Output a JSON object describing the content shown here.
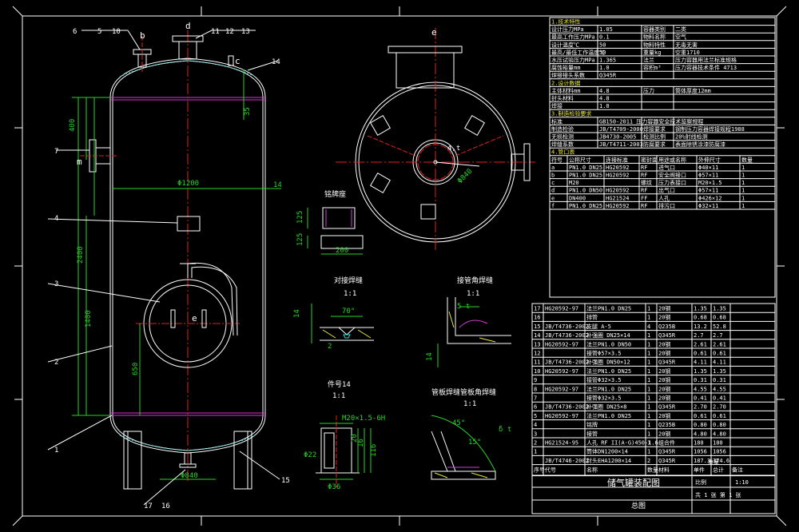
{
  "drawing": {
    "dims": {
      "d_1200": "Φ1200",
      "d_400": "400",
      "d_2400": "2400",
      "d_1400": "1400",
      "d_650": "650",
      "d_14": "14",
      "d_35": "35",
      "d_840": "Φ840",
      "d_840b": "Φ840",
      "d_125": "125",
      "d_200": "200",
      "d_14b": "14",
      "d_70deg": "70°",
      "d_2": "2",
      "d_5t": "5 t",
      "d_45": "45°",
      "d_15": "15°",
      "d_8t": "δ t",
      "d_m20": "M20×1.5-6H",
      "d_22": "Φ22",
      "d_36": "Φ36",
      "d_20": "20",
      "d_16": "16",
      "d_116": "116",
      "d_4t": "4,t"
    },
    "nozzle_letters": {
      "b": "b",
      "d": "d",
      "c": "c",
      "m": "m",
      "e": "e",
      "f": "f",
      "g": "g",
      "a": "a"
    },
    "leaders_top": {
      "l_6": "6",
      "l_5": "5",
      "l_10": "10",
      "l_11": "11",
      "l_12": "12",
      "l_13": "13",
      "l_14": "14"
    },
    "leaders_left": {
      "l_7": "7",
      "l_8": "8",
      "l_4": "4",
      "l_3": "3",
      "l_2": "2",
      "l_1": "1",
      "l_15": "15",
      "l_17": "17",
      "l_16": "16"
    },
    "detail_titles": {
      "nameplate": "铭牌座",
      "butt_weld": "对接焊缝",
      "corner_weld": "接管角焊缝",
      "part14": "件号14",
      "head_weld": "管板焊缝管板角焊缝"
    },
    "scales": {
      "s1": "1:1",
      "s2": "1:1",
      "s3": "1:1",
      "s4": "1:1"
    }
  },
  "spec_table": {
    "header1": "1.技术特性",
    "rows": [
      [
        "设计压力MPa",
        "1.05",
        "容器类别",
        "二类"
      ],
      [
        "最高工作压力MPa",
        "0.1",
        "物料名称",
        "空气"
      ],
      [
        "设计温度℃",
        "50",
        "物料特性",
        "无毒无害"
      ],
      [
        "最高/最低工作温度℃",
        "50",
        "重量kg",
        "空重1710"
      ],
      [
        "水压试验压力MPa",
        "1.365",
        "法兰",
        "压力容器用法兰标准规格"
      ],
      [
        "腐蚀裕量mm",
        "1.0",
        "容积m³",
        "压力容器技术条件 4713"
      ],
      [
        "焊接接头系数",
        "Q345R",
        "",
        ""
      ]
    ],
    "header2": "2.设计数据",
    "rows2": [
      [
        "主体材料mm",
        "4.8",
        "压力",
        "筒体厚度12mm"
      ],
      [
        "封头材料",
        "4.8",
        "",
        ""
      ],
      [
        "焊接",
        "1.0",
        "",
        ""
      ]
    ],
    "header3": "3.制造检验要求",
    "rows3": [
      [
        "标准",
        "GB150-2011 压力容器安全技术监察规程",
        "",
        ""
      ],
      [
        "制造检验",
        "JB/T4709-2000",
        "焊接要求",
        "钢制压力容器焊接规程1988"
      ],
      [
        "无损检测",
        "JB4730-2005",
        "检测比例",
        "20%射线检测"
      ],
      [
        "焊缝系数",
        "JB/T4711-2003",
        "防腐要求",
        "表面除锈涂漆防腐漆"
      ]
    ],
    "header4": "4.管口表",
    "nozzle_header": [
      "符号",
      "公称尺寸",
      "连接标准",
      "密封面",
      "用途或名称",
      "外伸尺寸",
      "数量"
    ],
    "nozzles": [
      [
        "a",
        "PN1.0 DN25",
        "HG20592",
        "RF",
        "进气口",
        "Φ40×11",
        "1"
      ],
      [
        "b",
        "PN1.0 DN25",
        "HG20592",
        "RF",
        "安全阀接口",
        "Φ57×11",
        "1"
      ],
      [
        "c",
        "M20",
        "",
        "螺纹",
        "压力表接口",
        "M20×1.5",
        "1"
      ],
      [
        "d",
        "PN1.0 DN50",
        "HG20592",
        "RF",
        "出气口",
        "Φ57×11",
        "1"
      ],
      [
        "e",
        "DN400",
        "HG21524",
        "FF",
        "人孔",
        "Φ426×12",
        "1"
      ],
      [
        "f",
        "PN1.0 DN25",
        "HG20592",
        "RF",
        "排污口",
        "Φ32×11",
        "1"
      ]
    ]
  },
  "parts_table": {
    "rows": [
      [
        "17",
        "HG20592-97",
        "法兰PN1.0 DN25",
        "1",
        "20钢",
        "1.35",
        "1.35"
      ],
      [
        "16",
        "",
        "排管",
        "1",
        "20钢",
        "0.68",
        "0.68"
      ],
      [
        "15",
        "JB/T4736-2002",
        "支腿 A-5",
        "4",
        "Q235B",
        "13.2",
        "52.8"
      ],
      [
        "14",
        "JB/T4736-2002",
        "补强圈 DN25×14",
        "1",
        "Q345R",
        "2.7",
        "2.7"
      ],
      [
        "13",
        "HG20592-97",
        "法兰PN1.0 DN50",
        "1",
        "20钢",
        "2.61",
        "2.61"
      ],
      [
        "12",
        "",
        "接管Φ57×3.5",
        "1",
        "20钢",
        "0.61",
        "0.61"
      ],
      [
        "11",
        "JB/T4736-2002",
        "补强圈 DN50×12",
        "1",
        "Q345R",
        "4.11",
        "4.11"
      ],
      [
        "10",
        "HG20592-97",
        "法兰PN1.0 DN25",
        "1",
        "20钢",
        "1.35",
        "1.35"
      ],
      [
        "9",
        "",
        "接管Φ32×3.5",
        "1",
        "20钢",
        "0.31",
        "0.31"
      ],
      [
        "8",
        "HG20592-97",
        "法兰PN1.0 DN25",
        "1",
        "20钢",
        "4.55",
        "4.55"
      ],
      [
        "7",
        "",
        "接管Φ32×3.5",
        "1",
        "20钢",
        "0.41",
        "0.41"
      ],
      [
        "6",
        "JB/T4736-2002",
        "补强圈 DN25×8",
        "1",
        "Q345R",
        "2.70",
        "2.70"
      ],
      [
        "5",
        "HG20592-97",
        "法兰PN1.0 DN25",
        "1",
        "20钢",
        "0.61",
        "0.61"
      ],
      [
        "4",
        "",
        "铭牌",
        "1",
        "Q235B",
        "0.80",
        "0.80"
      ],
      [
        "3",
        "",
        "接管",
        "1",
        "20钢",
        "4.80",
        "4.80"
      ],
      [
        "2",
        "HG21524-95",
        "人孔 RF II(A·G)450-1.6",
        "1",
        "组合件",
        "180",
        "180"
      ],
      [
        "1",
        "",
        "筒体DN1200×14",
        "1",
        "Q345R",
        "1056",
        "1056"
      ],
      [
        "",
        "JB/T4746-2002",
        "封头EHA1200×14",
        "2",
        "Q345R",
        "187.3",
        "374.6"
      ]
    ],
    "header": [
      "序号",
      "代号",
      "名称",
      "数量",
      "材料",
      "单件",
      "总计",
      "备注"
    ],
    "header_sub": "重量"
  },
  "title_block": {
    "title": "储气罐装配图",
    "sub": "总图",
    "ratio": "1:10",
    "sheet": "共 1 张 第 1 张",
    "scale_label": "比例"
  }
}
